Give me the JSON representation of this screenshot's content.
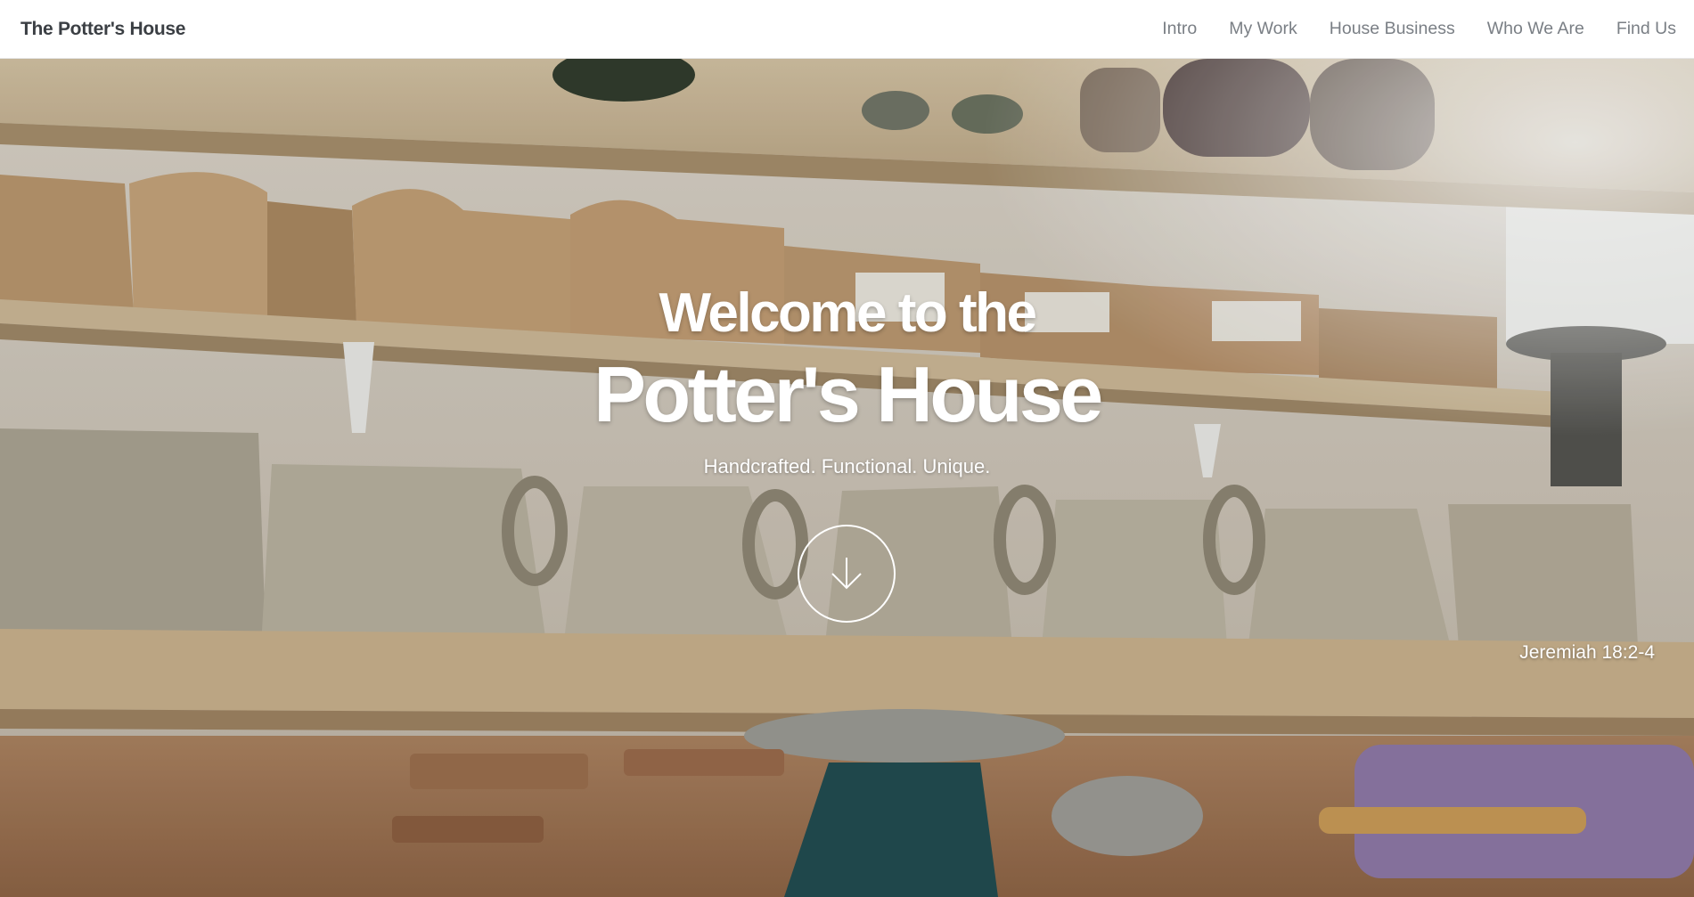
{
  "header": {
    "brand": "The Potter's House",
    "nav": [
      {
        "label": "Intro"
      },
      {
        "label": "My Work"
      },
      {
        "label": "House Business"
      },
      {
        "label": "Who We Are"
      },
      {
        "label": "Find Us"
      }
    ]
  },
  "hero": {
    "heading_line1": "Welcome to the",
    "heading_line2": "Potter's House",
    "tagline": "Handcrafted. Functional. Unique.",
    "scroll_icon": "arrow-down-icon",
    "verse": "Jeremiah 18:2-4",
    "background": "pottery-studio-shelves-photo"
  },
  "colors": {
    "header_bg": "#ffffff",
    "brand_text": "#3b3f44",
    "nav_text": "#7a7f85",
    "hero_text": "#ffffff"
  }
}
